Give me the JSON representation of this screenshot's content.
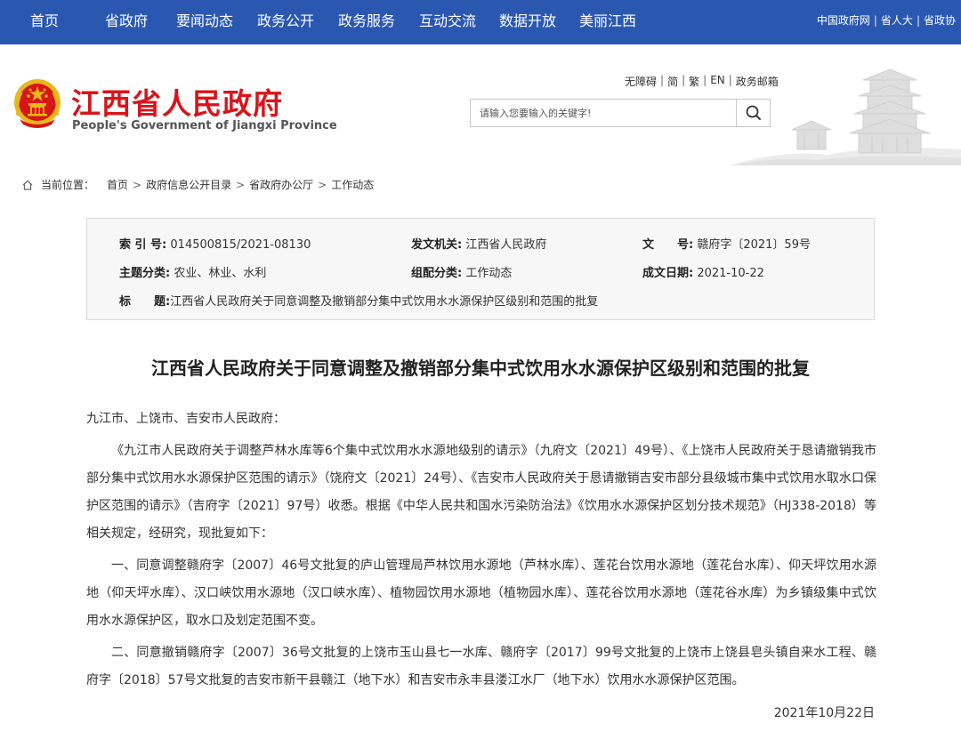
{
  "nav": {
    "items": [
      "首页",
      "省政府",
      "要闻动态",
      "政务公开",
      "政务服务",
      "互动交流",
      "数据开放",
      "美丽江西"
    ],
    "links": [
      "中国政府网",
      "省人大",
      "省政协"
    ]
  },
  "header": {
    "title": "江西省人民政府",
    "subtitle": "People's Government of Jiangxi Province",
    "utility": [
      "无障碍",
      "简",
      "繁",
      "EN",
      "政务邮箱"
    ],
    "search_placeholder": "请输入您要输入的关键字!"
  },
  "breadcrumb": {
    "label": "当前位置：",
    "items": [
      "首页",
      "政府信息公开目录",
      "省政府办公厅",
      "工作动态"
    ]
  },
  "info": {
    "index_label": "索 引 号:",
    "index_value": "014500815/2021-08130",
    "issuer_label": "发文机关:",
    "issuer_value": "江西省人民政府",
    "docno_label": "文　　号:",
    "docno_value": "赣府字〔2021〕59号",
    "topic_label": "主题分类:",
    "topic_value": "农业、林业、水利",
    "group_label": "组配分类:",
    "group_value": "工作动态",
    "date_label": "成文日期:",
    "date_value": "2021-10-22",
    "title_label": "标　　题:",
    "title_value": "江西省人民政府关于同意调整及撤销部分集中式饮用水水源保护区级别和范围的批复"
  },
  "article": {
    "title": "江西省人民政府关于同意调整及撤销部分集中式饮用水水源保护区级别和范围的批复",
    "salutation": "九江市、上饶市、吉安市人民政府：",
    "paragraphs": [
      "《九江市人民政府关于调整芦林水库等6个集中式饮用水水源地级别的请示》（九府文〔2021〕49号）、《上饶市人民政府关于恳请撤销我市部分集中式饮用水水源保护区范围的请示》（饶府文〔2021〕24号）、《吉安市人民政府关于恳请撤销吉安市部分县级城市集中式饮用水取水口保护区范围的请示》（吉府字〔2021〕97号）收悉。根据《中华人民共和国水污染防治法》《饮用水水源保护区划分技术规范》（HJ338-2018）等相关规定，经研究，现批复如下：",
      "一、同意调整赣府字〔2007〕46号文批复的庐山管理局芦林饮用水源地（芦林水库）、莲花台饮用水源地（莲花台水库）、仰天坪饮用水源地（仰天坪水库）、汉口峡饮用水源地（汉口峡水库）、植物园饮用水源地（植物园水库）、莲花谷饮用水源地（莲花谷水库）为乡镇级集中式饮用水水源保护区，取水口及划定范围不变。",
      "二、同意撤销赣府字〔2007〕36号文批复的上饶市玉山县七一水库、赣府字〔2017〕99号文批复的上饶市上饶县皂头镇自来水工程、赣府字〔2018〕57号文批复的吉安市新干县赣江（地下水）和吉安市永丰县溇江水厂（地下水）饮用水水源保护区范围。"
    ],
    "date": "2021年10月22日"
  },
  "colors": {
    "nav_bg": "#2a58b1",
    "title_red": "#d8151a",
    "emblem_gold": "#e8b71a"
  },
  "icons": [
    "national-emblem-icon",
    "search-icon",
    "home-icon"
  ]
}
